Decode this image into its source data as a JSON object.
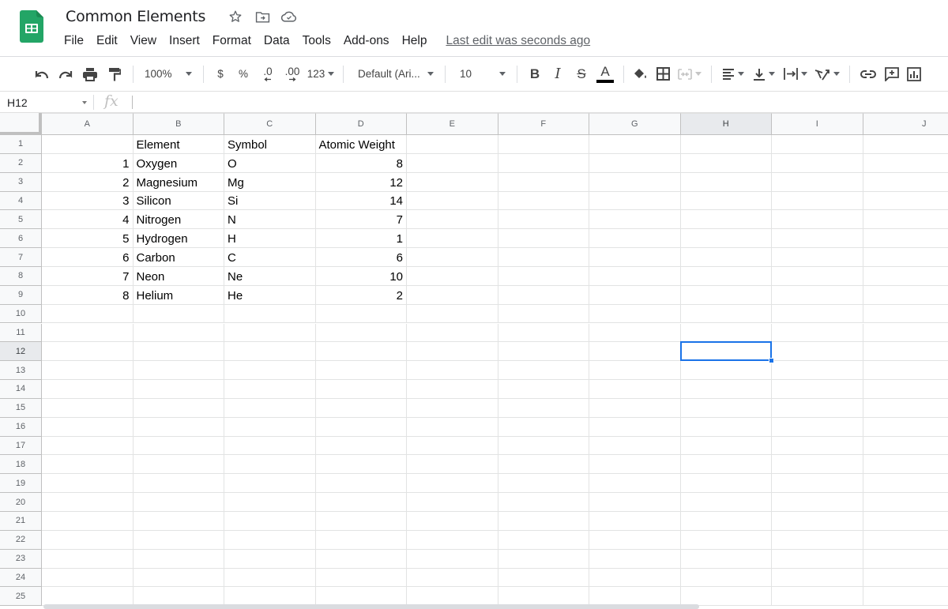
{
  "app": {
    "document_title": "Common Elements",
    "brand_color": "#23a566",
    "menu": [
      "File",
      "Edit",
      "View",
      "Insert",
      "Format",
      "Data",
      "Tools",
      "Add-ons",
      "Help"
    ],
    "last_edit": "Last edit was seconds ago"
  },
  "toolbar": {
    "zoom": "100%",
    "currency": "$",
    "percent": "%",
    "decrease_decimal": ".0",
    "increase_decimal": ".00",
    "more_formats": "123",
    "font": "Default (Ari...",
    "font_size": "10",
    "bold": "B",
    "italic": "I",
    "strikethrough": "S",
    "text_color_label": "A",
    "text_color": "#000000"
  },
  "formula_bar": {
    "name_box": "H12",
    "fx_label": "fx",
    "value": ""
  },
  "sheet": {
    "columns": [
      "A",
      "B",
      "C",
      "D",
      "E",
      "F",
      "G",
      "H",
      "I",
      "J"
    ],
    "row_count": 25,
    "selected_cell": "H12",
    "selected_column": "H",
    "selected_row": 12,
    "accent_color": "#1a73e8",
    "rows": [
      {
        "A": "",
        "B": "Element",
        "C": "Symbol",
        "D": "Atomic Weight"
      },
      {
        "A": "1",
        "B": "Oxygen",
        "C": "O",
        "D": "8"
      },
      {
        "A": "2",
        "B": "Magnesium",
        "C": "Mg",
        "D": "12"
      },
      {
        "A": "3",
        "B": "Silicon",
        "C": "Si",
        "D": "14"
      },
      {
        "A": "4",
        "B": "Nitrogen",
        "C": "N",
        "D": "7"
      },
      {
        "A": "5",
        "B": "Hydrogen",
        "C": "H",
        "D": "1"
      },
      {
        "A": "6",
        "B": "Carbon",
        "C": "C",
        "D": "6"
      },
      {
        "A": "7",
        "B": "Neon",
        "C": "Ne",
        "D": "10"
      },
      {
        "A": "8",
        "B": "Helium",
        "C": "He",
        "D": "2"
      }
    ]
  }
}
